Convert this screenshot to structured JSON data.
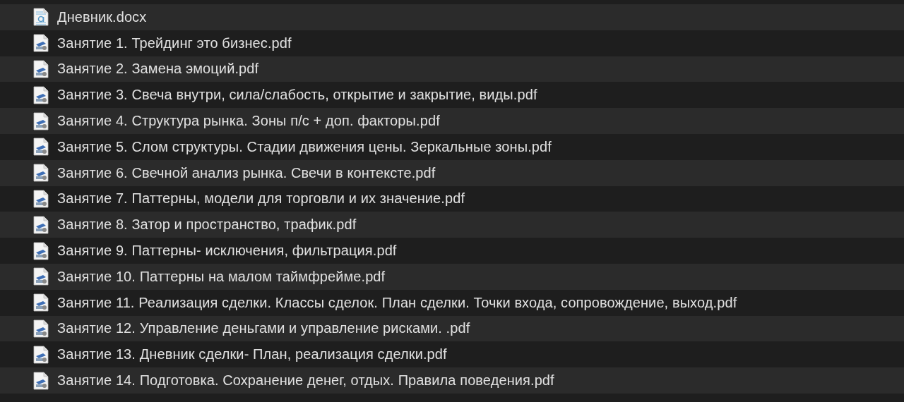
{
  "files": [
    {
      "name": "Дневник.docx",
      "kind": "docx"
    },
    {
      "name": "Занятие 1. Трейдинг это бизнес.pdf",
      "kind": "pdf"
    },
    {
      "name": "Занятие 2. Замена эмоций.pdf",
      "kind": "pdf"
    },
    {
      "name": "Занятие 3. Свеча внутри, сила/слабость, открытие и закрытие, виды.pdf",
      "kind": "pdf"
    },
    {
      "name": "Занятие 4. Структура рынка. Зоны п/с + доп. факторы.pdf",
      "kind": "pdf"
    },
    {
      "name": "Занятие 5. Слом структуры. Стадии движения цены. Зеркальные зоны.pdf",
      "kind": "pdf"
    },
    {
      "name": "Занятие 6. Свечной анализ рынка. Свечи в контексте.pdf",
      "kind": "pdf"
    },
    {
      "name": "Занятие 7. Паттерны, модели для торговли и их значение.pdf",
      "kind": "pdf"
    },
    {
      "name": "Занятие 8. Затор и пространство, трафик.pdf",
      "kind": "pdf"
    },
    {
      "name": "Занятие 9. Паттерны- исключения, фильтрация.pdf",
      "kind": "pdf"
    },
    {
      "name": "Занятие 10. Паттерны на малом таймфрейме.pdf",
      "kind": "pdf"
    },
    {
      "name": "Занятие 11. Реализация сделки. Классы сделок. План сделки. Точки входа, сопровождение, выход.pdf",
      "kind": "pdf"
    },
    {
      "name": "Занятие 12. Управление деньгами и управление рисками. .pdf",
      "kind": "pdf"
    },
    {
      "name": "Занятие 13. Дневник сделки- План, реализация сделки.pdf",
      "kind": "pdf"
    },
    {
      "name": "Занятие 14. Подготовка. Сохранение денег, отдых. Правила поведения.pdf",
      "kind": "pdf"
    }
  ]
}
